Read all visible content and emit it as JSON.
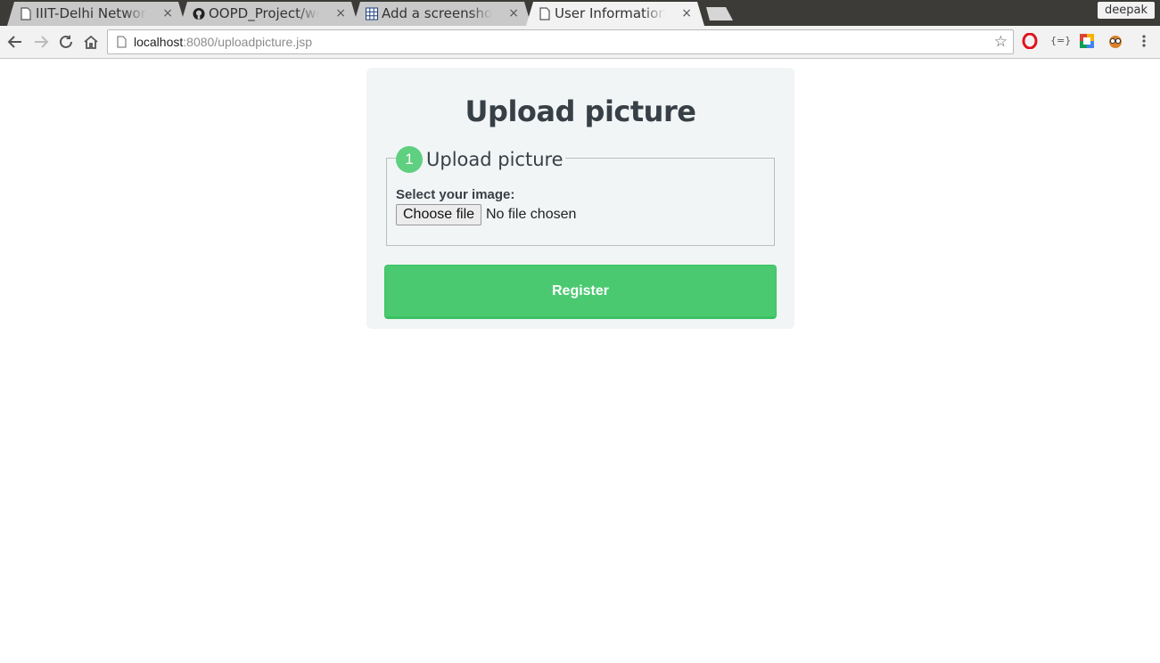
{
  "browser": {
    "tabs": [
      {
        "title": "IIIT-Delhi Network Security",
        "icon": "page-icon",
        "close": "×"
      },
      {
        "title": "OOPD_Project/web",
        "icon": "github-icon",
        "close": "×"
      },
      {
        "title": "Add a screenshot to",
        "icon": "grid-icon",
        "close": "×"
      },
      {
        "title": "User Information U",
        "icon": "page-icon",
        "close": "×"
      }
    ],
    "profile_name": "deepak",
    "url_host": "localhost",
    "url_rest": ":8080/uploadpicture.jsp",
    "nav_icons": {
      "back": "arrow-left-icon",
      "forward": "arrow-right-icon",
      "reload": "reload-icon",
      "home": "home-icon"
    },
    "extensions": [
      "opera-icon",
      "json-icon",
      "google-extension-icon",
      "owl-icon",
      "menu-icon"
    ]
  },
  "page": {
    "title": "Upload picture",
    "section": {
      "step": "1",
      "label": "Upload picture",
      "field_label": "Select your image:",
      "file_button": "Choose file",
      "file_status": "No file chosen"
    },
    "submit_label": "Register"
  },
  "colors": {
    "accent_green": "#4bc970",
    "badge_green": "#5fcf80",
    "card_bg": "#f1f5f6",
    "heading": "#384047"
  }
}
